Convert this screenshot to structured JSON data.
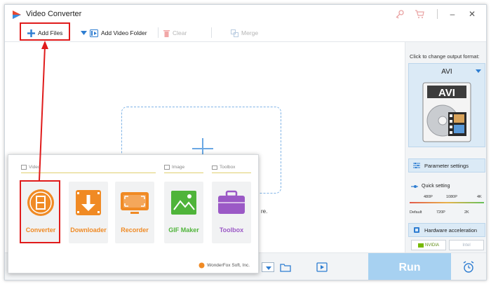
{
  "window": {
    "title": "Video Converter"
  },
  "toolbar": {
    "add_files": "Add Files",
    "add_video_folder": "Add Video Folder",
    "clear": "Clear",
    "merge": "Merge"
  },
  "main": {
    "drop_hint_tail": "re."
  },
  "right_panel": {
    "output_caption": "Click to change output format:",
    "format": "AVI",
    "format_icon_text": "AVI",
    "parameter_settings": "Parameter settings",
    "quick_setting": "Quick setting",
    "quality_top": [
      "480P",
      "1080P",
      "4K"
    ],
    "quality_bottom": [
      "Default",
      "720P",
      "2K"
    ],
    "hardware_acceleration": "Hardware acceleration",
    "gpu": [
      "NVIDIA",
      "Intel"
    ]
  },
  "bottom": {
    "run": "Run"
  },
  "popup": {
    "sections": {
      "video": "Video",
      "image": "Image",
      "toolbox": "Toolbox"
    },
    "tiles": [
      {
        "label": "Converter",
        "color": "#f08a24"
      },
      {
        "label": "Downloader",
        "color": "#f08a24"
      },
      {
        "label": "Recorder",
        "color": "#f08a24"
      },
      {
        "label": "GIF Maker",
        "color": "#4fb43a"
      },
      {
        "label": "Toolbox",
        "color": "#9b59c6"
      }
    ],
    "footer": "WonderFox Soft, Inc."
  },
  "colors": {
    "accent": "#2e7dd1",
    "highlight": "#e01b1b",
    "run_bg": "#a7d1f1"
  }
}
